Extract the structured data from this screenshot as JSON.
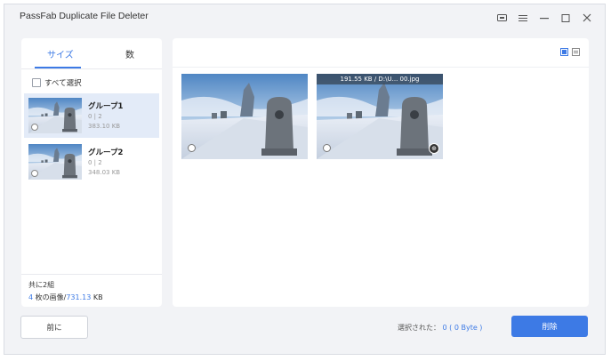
{
  "window": {
    "title": "PassFab Duplicate File Deleter"
  },
  "left_panel": {
    "tabs": [
      {
        "label": "サイズ"
      },
      {
        "label": "数"
      }
    ],
    "select_all_label": "すべて選択",
    "groups": [
      {
        "name": "グループ1",
        "count": "0 | 2",
        "size": "383.10 KB"
      },
      {
        "name": "グループ2",
        "count": "0 | 2",
        "size": "348.03 KB"
      }
    ],
    "footer": {
      "total": "共に2組",
      "images_count": "4",
      "images_label": " 枚の画像/",
      "images_size": "731.13",
      "size_unit": " KB"
    }
  },
  "right_panel": {
    "cards": [
      {
        "label": ""
      },
      {
        "label": "191.55 KB / D:\\U... 00.jpg"
      }
    ]
  },
  "bottom": {
    "back_label": "前に",
    "selected_label": "選択された： ",
    "selected_count": "0",
    "selected_bytes": " ( 0 Byte )",
    "delete_label": "削除"
  },
  "colors": {
    "accent": "#3d7ae5"
  }
}
